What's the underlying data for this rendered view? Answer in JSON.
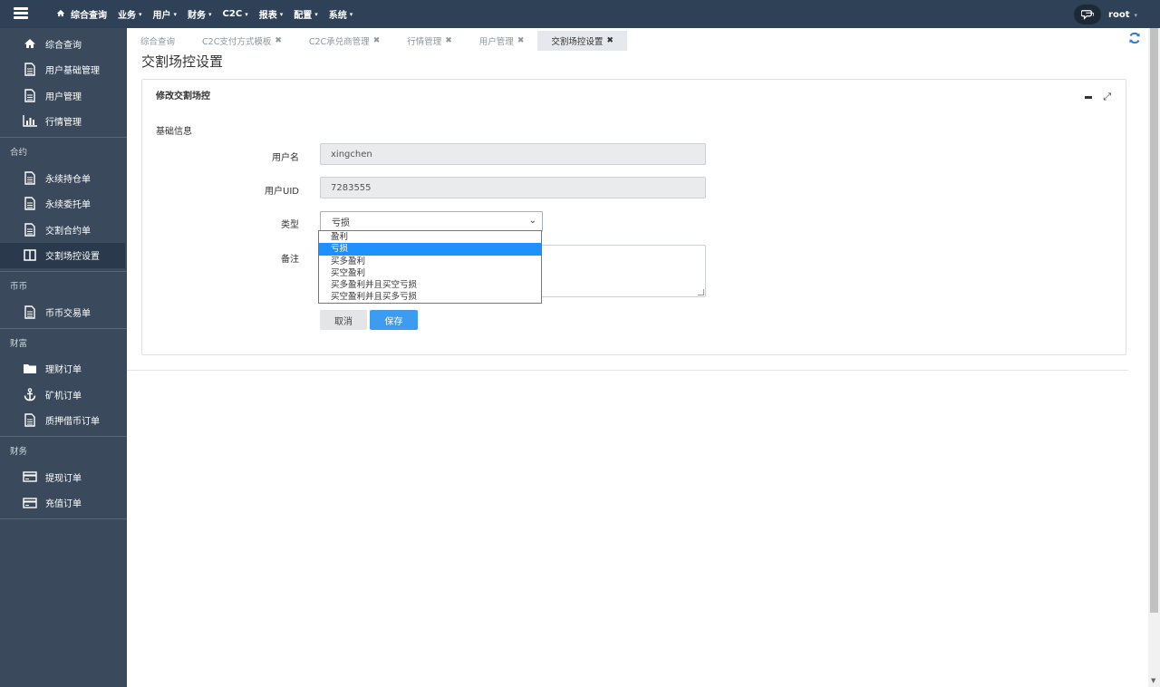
{
  "topnav": {
    "items": [
      {
        "label": "综合查询",
        "has_caret": false
      },
      {
        "label": "业务",
        "has_caret": true
      },
      {
        "label": "用户",
        "has_caret": true
      },
      {
        "label": "财务",
        "has_caret": true
      },
      {
        "label": "C2C",
        "has_caret": true
      },
      {
        "label": "报表",
        "has_caret": true
      },
      {
        "label": "配置",
        "has_caret": true
      },
      {
        "label": "系统",
        "has_caret": true
      }
    ],
    "caret": "▾",
    "user": "root"
  },
  "sidebar": {
    "top_items": [
      {
        "label": "综合查询",
        "icon": "home-icon"
      },
      {
        "label": "用户基础管理",
        "icon": "document-icon"
      },
      {
        "label": "用户管理",
        "icon": "document-icon"
      },
      {
        "label": "行情管理",
        "icon": "bar-chart-icon"
      }
    ],
    "groups": [
      {
        "label": "合约",
        "items": [
          {
            "label": "永续持仓单",
            "icon": "document-icon"
          },
          {
            "label": "永续委托单",
            "icon": "document-icon"
          },
          {
            "label": "交割合约单",
            "icon": "document-icon"
          },
          {
            "label": "交割场控设置",
            "icon": "columns-icon",
            "active": true
          }
        ]
      },
      {
        "label": "币币",
        "items": [
          {
            "label": "币币交易单",
            "icon": "document-icon"
          }
        ]
      },
      {
        "label": "财富",
        "items": [
          {
            "label": "理财订单",
            "icon": "folder-icon"
          },
          {
            "label": "矿机订单",
            "icon": "anchor-icon"
          },
          {
            "label": "质押借币订单",
            "icon": "document-icon"
          }
        ]
      },
      {
        "label": "财务",
        "items": [
          {
            "label": "提现订单",
            "icon": "card-icon"
          },
          {
            "label": "充值订单",
            "icon": "card-icon"
          }
        ]
      }
    ]
  },
  "tabs": [
    {
      "label": "综合查询",
      "closable": false
    },
    {
      "label": "C2C支付方式模板",
      "closable": true
    },
    {
      "label": "C2C承兑商管理",
      "closable": true
    },
    {
      "label": "行情管理",
      "closable": true
    },
    {
      "label": "用户管理",
      "closable": true
    },
    {
      "label": "交割场控设置",
      "closable": true,
      "active": true
    }
  ],
  "page": {
    "title": "交割场控设置",
    "panel_title": "修改交割场控",
    "section_title": "基础信息"
  },
  "form": {
    "username_label": "用户名",
    "username_value": "xingchen",
    "uid_label": "用户UID",
    "uid_value": "7283555",
    "type_label": "类型",
    "type_value": "亏损",
    "type_options": [
      "盈利",
      "亏损",
      "买多盈利",
      "买空盈利",
      "买多盈利并且买空亏损",
      "买空盈利并且买多亏损"
    ],
    "type_selected_index": 1,
    "remark_label": "备注",
    "cancel_label": "取消",
    "save_label": "保存"
  },
  "colors": {
    "topbar": "#2f4156",
    "sidebar": "#3a4a5c",
    "primary_button": "#3d9cf0",
    "selected_option": "#1e90ff"
  }
}
